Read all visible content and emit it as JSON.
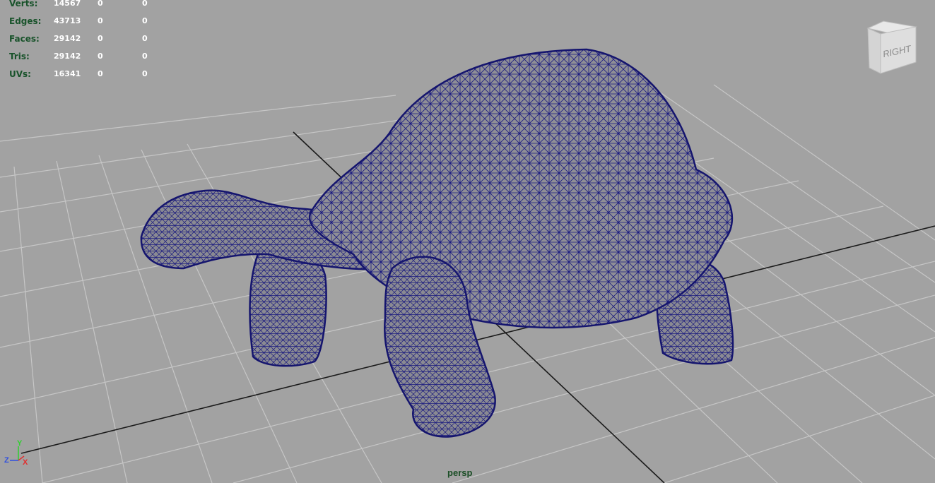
{
  "hud": {
    "rows": [
      {
        "label": "Verts:",
        "v1": "14567",
        "v2": "0",
        "v3": "0"
      },
      {
        "label": "Edges:",
        "v1": "43713",
        "v2": "0",
        "v3": "0"
      },
      {
        "label": "Faces:",
        "v1": "29142",
        "v2": "0",
        "v3": "0"
      },
      {
        "label": "Tris:",
        "v1": "29142",
        "v2": "0",
        "v3": "0"
      },
      {
        "label": "UVs:",
        "v1": "16341",
        "v2": "0",
        "v3": "0"
      }
    ]
  },
  "viewport": {
    "camera": "persp",
    "viewcube_face": "RIGHT",
    "axes": {
      "y": "Y",
      "x": "X",
      "z": "Z"
    }
  },
  "colors": {
    "background": "#a2a2a2",
    "grid": "#c6c6c6",
    "grid_axis": "#1a1a1a",
    "wireframe": "#1a1a80",
    "mesh_fill": "#8f8f96",
    "hud_label": "#19532b",
    "hud_value": "#ffffff"
  }
}
